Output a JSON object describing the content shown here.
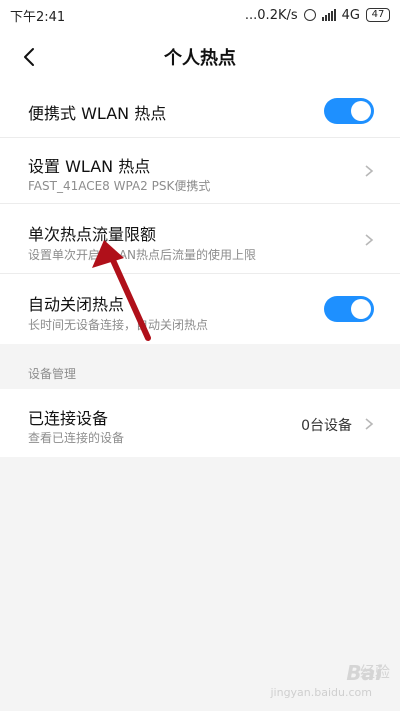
{
  "status_bar": {
    "time": "下午2:41",
    "speed": "...0.2K/s",
    "network": "4G",
    "battery": "47"
  },
  "header": {
    "title": "个人热点"
  },
  "settings": {
    "portable_hotspot": {
      "label": "便携式 WLAN 热点",
      "enabled": true
    },
    "set_hotspot": {
      "label": "设置 WLAN 热点",
      "sub": "FAST_41ACE8 WPA2 PSK便携式"
    },
    "data_limit": {
      "label": "单次热点流量限额",
      "sub": "设置单次开启WLAN热点后流量的使用上限"
    },
    "auto_off": {
      "label": "自动关闭热点",
      "sub": "长时间无设备连接，自动关闭热点",
      "enabled": true
    }
  },
  "device_section": {
    "title": "设备管理",
    "connected_devices": {
      "label": "已连接设备",
      "sub": "查看已连接的设备",
      "value": "0台设备"
    }
  },
  "watermark": {
    "brand": "Bai",
    "brand_suffix": "经验",
    "url": "jingyan.baidu.com"
  },
  "colors": {
    "accent": "#1e90ff",
    "arrow": "#b0101a"
  }
}
